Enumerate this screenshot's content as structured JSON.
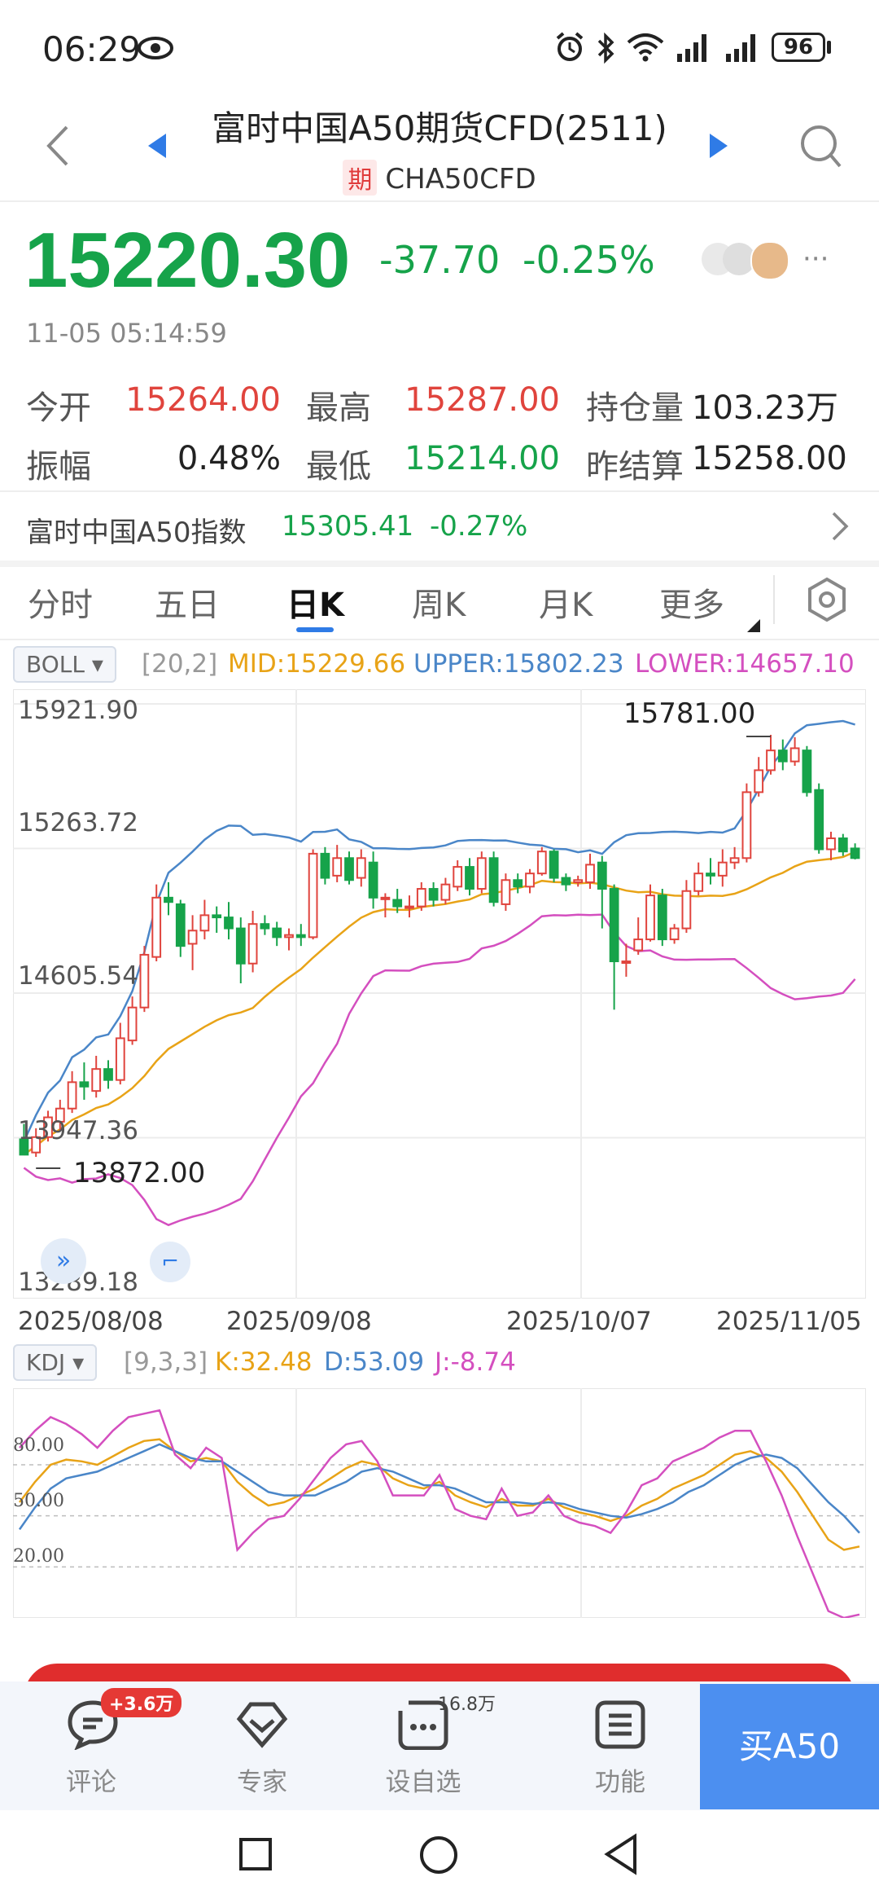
{
  "status": {
    "time": "06:29",
    "battery": "96"
  },
  "header": {
    "title": "富时中国A50期货CFD(2511)",
    "tag": "期",
    "symbol": "CHA50CFD"
  },
  "quote": {
    "price": "15220.30",
    "change": "-37.70",
    "change_pct": "-0.25%",
    "timestamp": "11-05 05:14:59",
    "stats": [
      {
        "label": "今开",
        "value": "15264.00",
        "color": "red"
      },
      {
        "label": "最高",
        "value": "15287.00",
        "color": "red"
      },
      {
        "label": "持仓量",
        "value": "103.23万",
        "color": "dark"
      },
      {
        "label": "振幅",
        "value": "0.48%",
        "color": "dark"
      },
      {
        "label": "最低",
        "value": "15214.00",
        "color": "green"
      },
      {
        "label": "昨结算",
        "value": "15258.00",
        "color": "dark"
      }
    ]
  },
  "index_row": {
    "label": "富时中国A50指数",
    "value": "15305.41",
    "change_pct": "-0.27%"
  },
  "tabs": [
    "分时",
    "五日",
    "日K",
    "周K",
    "月K",
    "更多"
  ],
  "active_tab": "日K",
  "boll": {
    "name": "BOLL",
    "params": "[20,2]",
    "mid": "MID:15229.66",
    "upper": "UPPER:15802.23",
    "lower": "LOWER:14657.10"
  },
  "kdj": {
    "name": "KDJ",
    "params": "[9,3,3]",
    "k": "K:32.48",
    "d": "D:53.09",
    "j": "J:-8.74"
  },
  "colors": {
    "up": "#e0443d",
    "down": "#16a34a",
    "mid": "#e8a317",
    "upper": "#4a86c8",
    "lower": "#d44fbf",
    "accent": "#2f7be6"
  },
  "chart_data": [
    {
      "type": "candlestick",
      "y_axis_labels": [
        "15921.90",
        "15263.72",
        "14605.54",
        "13947.36",
        "13289.18"
      ],
      "ylim": [
        13289.18,
        15921.9
      ],
      "x_axis_labels": [
        "2025/08/08",
        "2025/09/08",
        "2025/10/07",
        "2025/11/05"
      ],
      "annotations": {
        "high": "15781.00",
        "low": "13872.00"
      },
      "candles": [
        [
          13940,
          13870,
          14010,
          13880
        ],
        [
          13880,
          13950,
          13990,
          13860
        ],
        [
          13950,
          14040,
          14070,
          13930
        ],
        [
          14020,
          14080,
          14120,
          13980
        ],
        [
          14080,
          14200,
          14250,
          14060
        ],
        [
          14200,
          14180,
          14290,
          14120
        ],
        [
          14160,
          14260,
          14320,
          14130
        ],
        [
          14260,
          14210,
          14300,
          14170
        ],
        [
          14210,
          14400,
          14470,
          14190
        ],
        [
          14390,
          14540,
          14590,
          14370
        ],
        [
          14540,
          14780,
          14820,
          14520
        ],
        [
          14770,
          15040,
          15100,
          14750
        ],
        [
          15040,
          15020,
          15110,
          14960
        ],
        [
          15010,
          14820,
          15030,
          14770
        ],
        [
          14830,
          14890,
          14960,
          14710
        ],
        [
          14890,
          14960,
          15030,
          14850
        ],
        [
          14960,
          14950,
          15000,
          14880
        ],
        [
          14950,
          14900,
          15020,
          14850
        ],
        [
          14900,
          14740,
          14950,
          14650
        ],
        [
          14740,
          14920,
          14980,
          14700
        ],
        [
          14920,
          14900,
          14960,
          14870
        ],
        [
          14900,
          14860,
          14930,
          14820
        ],
        [
          14860,
          14870,
          14900,
          14800
        ],
        [
          14870,
          14860,
          14920,
          14820
        ],
        [
          14860,
          15240,
          15260,
          14850
        ],
        [
          15240,
          15130,
          15270,
          15100
        ],
        [
          15140,
          15220,
          15280,
          15110
        ],
        [
          15220,
          15120,
          15250,
          15100
        ],
        [
          15130,
          15220,
          15260,
          15090
        ],
        [
          15200,
          15040,
          15250,
          14990
        ],
        [
          15040,
          15040,
          15060,
          14950
        ],
        [
          15030,
          15000,
          15080,
          14970
        ],
        [
          15000,
          15000,
          15050,
          14950
        ],
        [
          15000,
          15080,
          15110,
          14980
        ],
        [
          15080,
          15030,
          15110,
          15000
        ],
        [
          15030,
          15100,
          15130,
          15010
        ],
        [
          15090,
          15180,
          15210,
          15070
        ],
        [
          15180,
          15080,
          15220,
          15050
        ],
        [
          15080,
          15220,
          15250,
          15060
        ],
        [
          15220,
          15020,
          15250,
          15000
        ],
        [
          15010,
          15120,
          15150,
          14980
        ],
        [
          15120,
          15090,
          15150,
          15060
        ],
        [
          15090,
          15150,
          15170,
          15060
        ],
        [
          15150,
          15250,
          15270,
          15140
        ],
        [
          15250,
          15130,
          15260,
          15110
        ],
        [
          15130,
          15100,
          15150,
          15070
        ],
        [
          15110,
          15120,
          15140,
          15090
        ],
        [
          15110,
          15190,
          15240,
          15080
        ],
        [
          15200,
          15080,
          15230,
          14900
        ],
        [
          15080,
          14750,
          15100,
          14530
        ],
        [
          14750,
          14750,
          14830,
          14680
        ],
        [
          14800,
          14850,
          14950,
          14780
        ],
        [
          14850,
          15050,
          15100,
          14840
        ],
        [
          15050,
          14850,
          15080,
          14820
        ],
        [
          14850,
          14900,
          14920,
          14830
        ],
        [
          14900,
          15070,
          15120,
          14880
        ],
        [
          15070,
          15150,
          15200,
          15050
        ],
        [
          15150,
          15140,
          15220,
          15100
        ],
        [
          15140,
          15200,
          15260,
          15090
        ],
        [
          15200,
          15220,
          15270,
          15170
        ],
        [
          15220,
          15520,
          15560,
          15200
        ],
        [
          15520,
          15620,
          15680,
          15500
        ],
        [
          15620,
          15710,
          15781,
          15600
        ],
        [
          15710,
          15660,
          15760,
          15620
        ],
        [
          15660,
          15720,
          15770,
          15640
        ],
        [
          15710,
          15520,
          15730,
          15500
        ],
        [
          15530,
          15260,
          15560,
          15240
        ],
        [
          15260,
          15310,
          15340,
          15210
        ],
        [
          15310,
          15250,
          15330,
          15230
        ],
        [
          15264,
          15220,
          15287,
          15214
        ]
      ]
    },
    {
      "type": "line",
      "name": "KDJ",
      "y_axis_labels": [
        "80.00",
        "50.00",
        "20.00"
      ],
      "ylim": [
        -10,
        125
      ],
      "series": [
        {
          "name": "K",
          "values": [
            58,
            70,
            80,
            83,
            82,
            80,
            85,
            90,
            94,
            95,
            88,
            82,
            84,
            82,
            70,
            62,
            56,
            58,
            62,
            66,
            72,
            78,
            82,
            80,
            72,
            68,
            66,
            70,
            62,
            58,
            55,
            60,
            56,
            56,
            60,
            55,
            52,
            50,
            47,
            50,
            56,
            60,
            66,
            70,
            74,
            80,
            86,
            88,
            84,
            76,
            64,
            50,
            36,
            30,
            32
          ]
        },
        {
          "name": "D",
          "values": [
            42,
            55,
            66,
            72,
            74,
            76,
            80,
            84,
            88,
            92,
            88,
            84,
            82,
            82,
            76,
            70,
            64,
            62,
            62,
            62,
            66,
            70,
            76,
            78,
            76,
            72,
            68,
            68,
            66,
            62,
            58,
            58,
            58,
            57,
            58,
            57,
            54,
            52,
            50,
            49,
            51,
            54,
            58,
            64,
            68,
            74,
            80,
            84,
            86,
            84,
            78,
            68,
            58,
            50,
            40
          ]
        },
        {
          "name": "J",
          "values": [
            90,
            100,
            108,
            104,
            98,
            90,
            100,
            108,
            110,
            112,
            86,
            78,
            90,
            84,
            30,
            40,
            48,
            50,
            60,
            72,
            84,
            92,
            94,
            82,
            62,
            62,
            62,
            74,
            54,
            50,
            48,
            66,
            50,
            52,
            62,
            50,
            46,
            44,
            40,
            52,
            68,
            72,
            82,
            86,
            90,
            96,
            100,
            100,
            82,
            62,
            38,
            16,
            -6,
            -10,
            -8
          ]
        }
      ]
    }
  ],
  "bottom_nav": {
    "items": [
      {
        "label": "评论",
        "badge": "+3.6万"
      },
      {
        "label": "专家"
      },
      {
        "label": "设自选",
        "count": "16.8万"
      },
      {
        "label": "功能"
      }
    ],
    "buy_label": "买A50"
  }
}
